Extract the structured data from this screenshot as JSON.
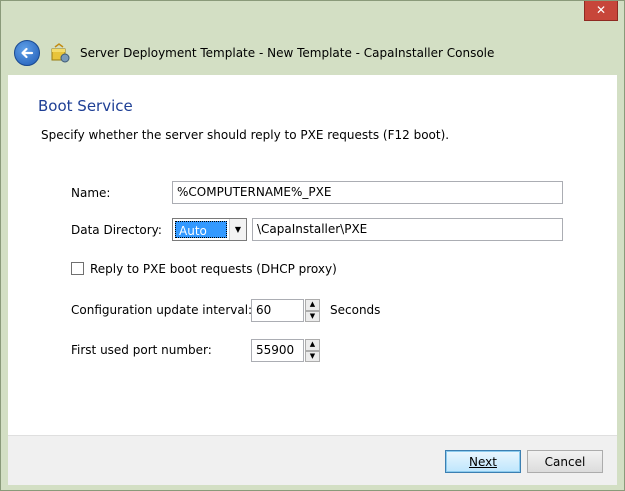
{
  "window": {
    "title": "Server Deployment Template - New Template - CapaInstaller Console",
    "close_glyph": "✕"
  },
  "page": {
    "heading": "Boot Service",
    "description": "Specify whether the server should reply to PXE requests (F12 boot)."
  },
  "form": {
    "name_label": "Name:",
    "name_value": "%COMPUTERNAME%_PXE",
    "data_dir_label": "Data Directory:",
    "data_dir_mode": "Auto",
    "data_dir_path": "\\CapaInstaller\\PXE",
    "reply_checkbox_label": "Reply to PXE boot requests (DHCP proxy)",
    "reply_checked": false,
    "config_interval_label": "Configuration update interval:",
    "config_interval_value": "60",
    "config_interval_unit": "Seconds",
    "first_port_label": "First used port number:",
    "first_port_value": "55900"
  },
  "footer": {
    "next_label": "Next",
    "cancel_label": "Cancel"
  },
  "colors": {
    "heading": "#1e3f95",
    "close": "#c7463a",
    "selection": "#3399ff"
  }
}
